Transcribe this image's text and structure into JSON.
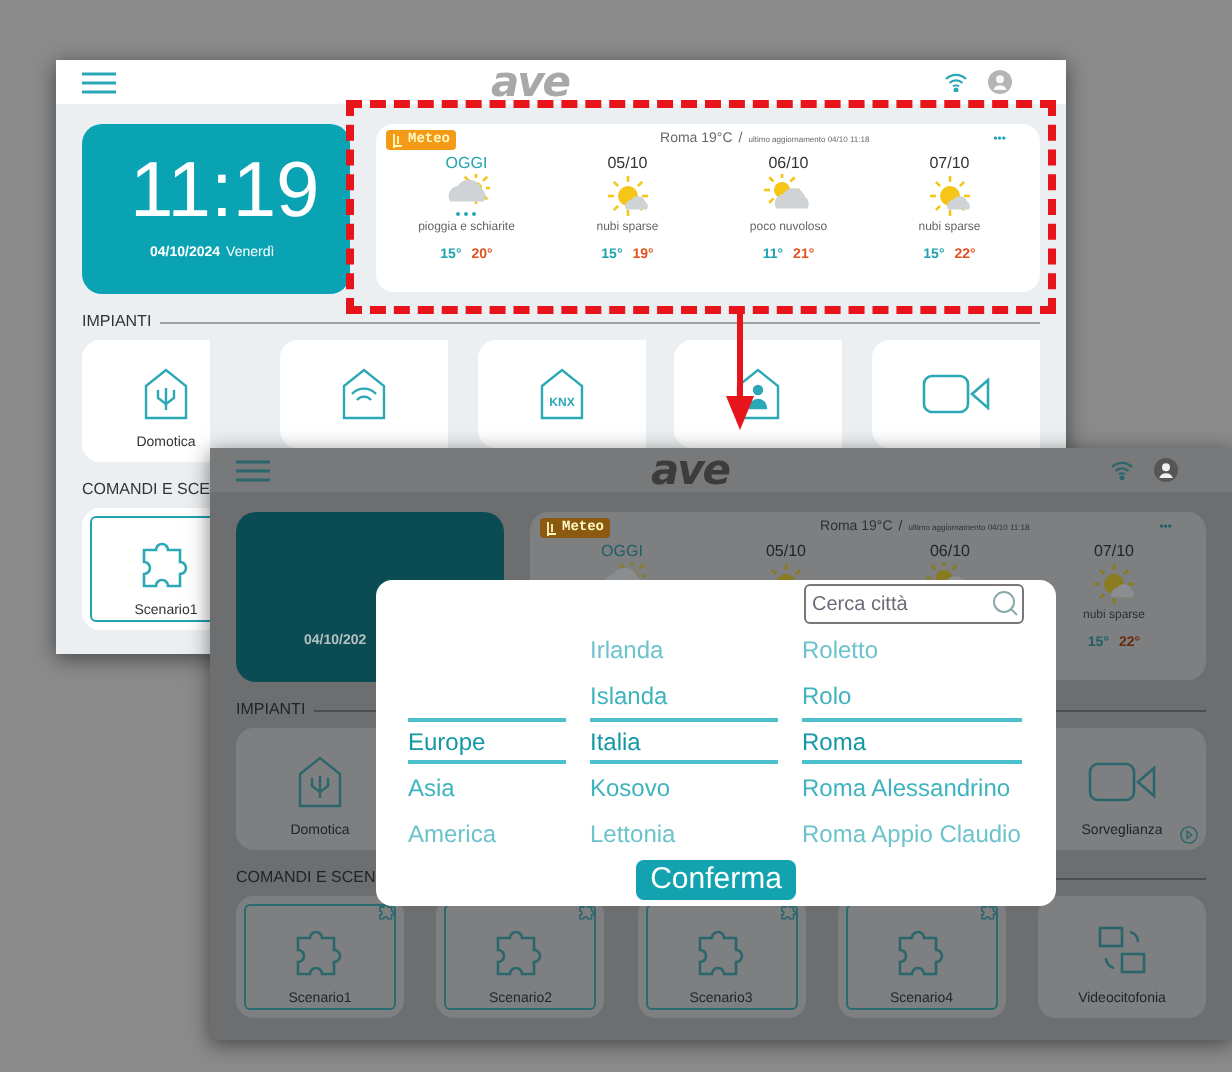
{
  "back_screen": {
    "dimmed": false,
    "logo": "ave",
    "clock": {
      "time": "11:19",
      "date": "04/10/2024",
      "weekday": "Venerdì"
    },
    "weather": {
      "highlighted": true,
      "badge": "Meteo",
      "location": "Roma 19°C",
      "separator": "/",
      "updated": "ultimo aggiornamento 04/10 11:18",
      "more": "•••",
      "days": [
        {
          "label": "OGGI",
          "today": true,
          "kind": "rain",
          "condition": "pioggia e schiarite",
          "min": "15°",
          "max": "20°"
        },
        {
          "label": "05/10",
          "today": false,
          "kind": "sun",
          "condition": "nubi sparse",
          "min": "15°",
          "max": "19°"
        },
        {
          "label": "06/10",
          "today": false,
          "kind": "cloud",
          "condition": "poco nuvoloso",
          "min": "11°",
          "max": "21°"
        },
        {
          "label": "07/10",
          "today": false,
          "kind": "sun",
          "condition": "nubi sparse",
          "min": "15°",
          "max": "22°"
        }
      ]
    },
    "sections": [
      {
        "title": "IMPIANTI",
        "tiles": [
          {
            "label": "Domotica",
            "kind": "domotica"
          },
          {
            "kind": "wifi"
          },
          {
            "kind": "knx",
            "icon_text": "KNX"
          },
          {
            "kind": "person"
          },
          {
            "kind": "camera"
          }
        ]
      },
      {
        "title": "COMANDI E SCE",
        "tiles": [
          {
            "label": "Scenario1",
            "kind": "puzzle",
            "outlined": true
          }
        ]
      }
    ]
  },
  "front_screen": {
    "dimmed": true,
    "logo": "ave",
    "clock": {
      "date": "04/10/202"
    },
    "weather": {
      "badge": "Meteo",
      "location": "Roma 19°C",
      "separator": "/",
      "updated": "ultimo aggiornamento 04/10 11:18",
      "more": "•••",
      "days": [
        {
          "label": "OGGI",
          "today": true,
          "kind": "rain"
        },
        {
          "label": "05/10",
          "today": false,
          "kind": "sun"
        },
        {
          "label": "06/10",
          "today": false,
          "kind": "cloud"
        },
        {
          "label": "07/10",
          "today": false,
          "kind": "sun",
          "condition": "nubi sparse",
          "min": "15°",
          "max": "22°"
        }
      ]
    },
    "sections": [
      {
        "title": "IMPIANTI",
        "tiles": [
          {
            "label": "Domotica",
            "kind": "domotica"
          },
          {
            "label": "Sorveglianza",
            "kind": "camera",
            "arrow_badge": true
          }
        ]
      },
      {
        "title": "COMANDI E SCEN",
        "tiles": [
          {
            "label": "Scenario1",
            "kind": "puzzle",
            "outlined": true,
            "corner_icon": true
          },
          {
            "label": "Scenario2",
            "kind": "puzzle",
            "outlined": true,
            "corner_icon": true
          },
          {
            "label": "Scenario3",
            "kind": "puzzle",
            "outlined": true,
            "corner_icon": true
          },
          {
            "label": "Scenario4",
            "kind": "puzzle",
            "outlined": true,
            "corner_icon": true
          },
          {
            "label": "Videocitofonia",
            "kind": "intercom",
            "outlined": false,
            "corner_icon": false
          }
        ]
      }
    ]
  },
  "picker": {
    "search": {
      "placeholder": "Cerca città"
    },
    "columns": [
      {
        "items": [
          {
            "label": "Europe",
            "selected": true
          },
          {
            "label": "Asia",
            "selected": false
          },
          {
            "label": "America",
            "selected": false
          }
        ]
      },
      {
        "items": [
          {
            "label": "Irlanda",
            "selected": false
          },
          {
            "label": "Islanda",
            "selected": false
          },
          {
            "label": "Italia",
            "selected": true
          },
          {
            "label": "Kosovo",
            "selected": false
          },
          {
            "label": "Lettonia",
            "selected": false
          }
        ]
      },
      {
        "items": [
          {
            "label": "Roletto",
            "selected": false
          },
          {
            "label": "Rolo",
            "selected": false
          },
          {
            "label": "Roma",
            "selected": true
          },
          {
            "label": "Roma Alessandrino",
            "selected": false
          },
          {
            "label": "Roma Appio Claudio",
            "selected": false
          }
        ]
      }
    ],
    "confirm": "Conferma"
  },
  "annotation": {
    "kind": "arrow"
  }
}
